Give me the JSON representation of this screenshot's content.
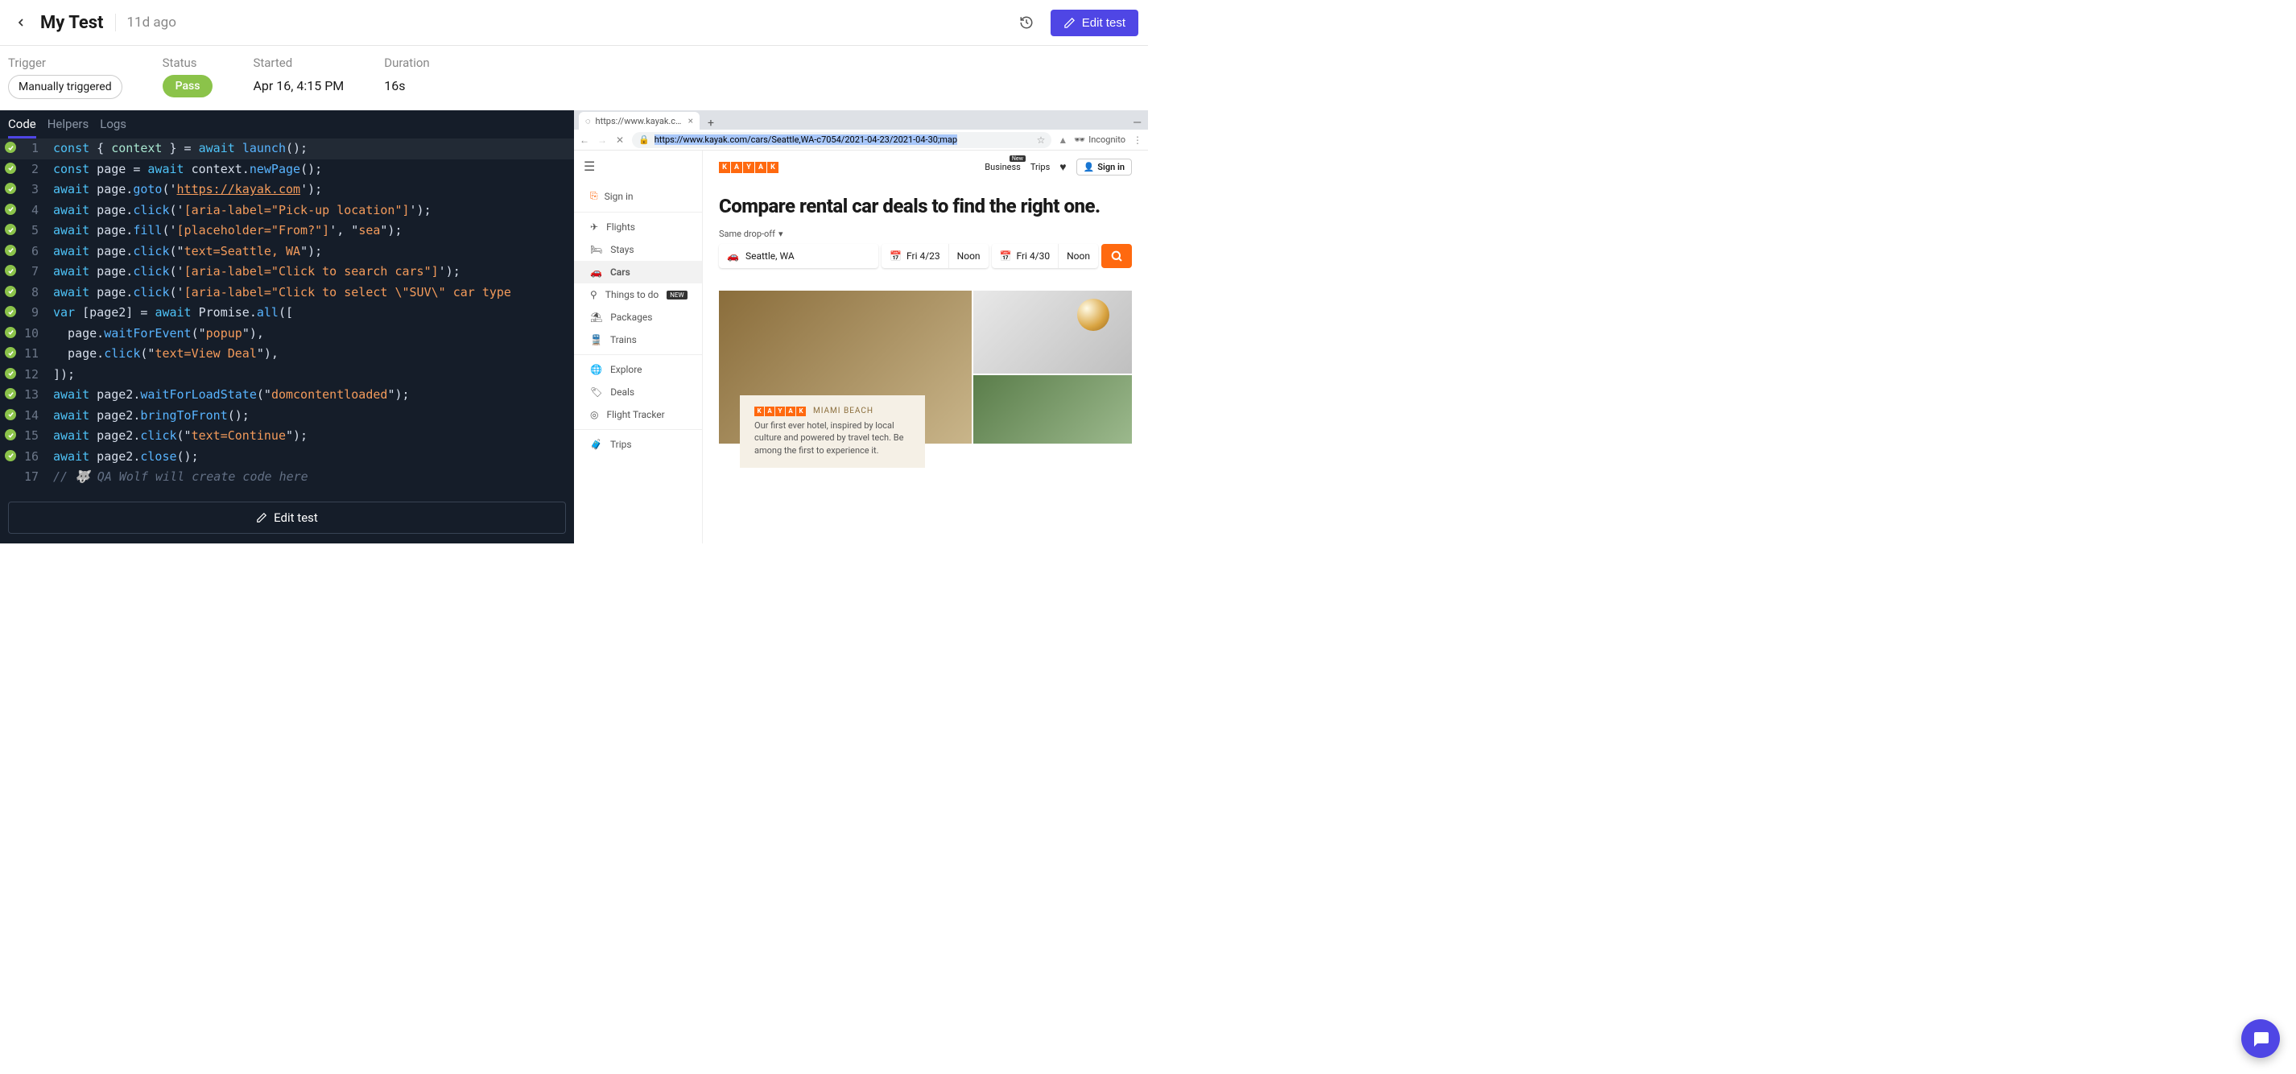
{
  "header": {
    "title": "My Test",
    "age": "11d ago",
    "edit_label": "Edit test"
  },
  "meta": {
    "trigger_label": "Trigger",
    "trigger_value": "Manually triggered",
    "status_label": "Status",
    "status_value": "Pass",
    "started_label": "Started",
    "started_value": "Apr 16, 4:15 PM",
    "duration_label": "Duration",
    "duration_value": "16s"
  },
  "tabs": {
    "code": "Code",
    "helpers": "Helpers",
    "logs": "Logs"
  },
  "code_url": "https://kayak.com",
  "code": {
    "l1_kw1": "const",
    "l1_br1": " { ",
    "l1_id": "context",
    "l1_br2": " } = ",
    "l1_aw": "await",
    "l1_sp": " ",
    "l1_fn": "launch",
    "l1_end": "();",
    "l2_kw": "const",
    "l2_a": " page = ",
    "l2_aw": "await",
    "l2_b": " context.",
    "l2_fn": "newPage",
    "l2_end": "();",
    "l3_aw": "await",
    "l3_a": " page.",
    "l3_fn": "goto",
    "l3_b": "('",
    "l3_end": "');",
    "l4_aw": "await",
    "l4_a": " page.",
    "l4_fn": "click",
    "l4_b": "('",
    "l4_str": "[aria-label=\"Pick-up location\"]",
    "l4_end": "');",
    "l5_aw": "await",
    "l5_a": " page.",
    "l5_fn": "fill",
    "l5_b": "('",
    "l5_str": "[placeholder=\"From?\"]",
    "l5_c": "', \"",
    "l5_str2": "sea",
    "l5_end": "\");",
    "l6_aw": "await",
    "l6_a": " page.",
    "l6_fn": "click",
    "l6_b": "(\"",
    "l6_str": "text=Seattle, WA",
    "l6_end": "\");",
    "l7_aw": "await",
    "l7_a": " page.",
    "l7_fn": "click",
    "l7_b": "('",
    "l7_str": "[aria-label=\"Click to search cars\"]",
    "l7_end": "');",
    "l8_aw": "await",
    "l8_a": " page.",
    "l8_fn": "click",
    "l8_b": "('",
    "l8_str": "[aria-label=\"Click to select \\\"SUV\\\" car type",
    "l9_kw": "var",
    "l9_a": " [page2] = ",
    "l9_aw": "await",
    "l9_b": " Promise.",
    "l9_fn": "all",
    "l9_end": "([",
    "l10_a": "  page.",
    "l10_fn": "waitForEvent",
    "l10_b": "(\"",
    "l10_str": "popup",
    "l10_end": "\"),",
    "l11_a": "  page.",
    "l11_fn": "click",
    "l11_b": "(\"",
    "l11_str": "text=View Deal",
    "l11_end": "\"),",
    "l12": "]);",
    "l13_aw": "await",
    "l13_a": " page2.",
    "l13_fn": "waitForLoadState",
    "l13_b": "(\"",
    "l13_str": "domcontentloaded",
    "l13_end": "\");",
    "l14_aw": "await",
    "l14_a": " page2.",
    "l14_fn": "bringToFront",
    "l14_end": "();",
    "l15_aw": "await",
    "l15_a": " page2.",
    "l15_fn": "click",
    "l15_b": "(\"",
    "l15_str": "text=Continue",
    "l15_end": "\");",
    "l16_aw": "await",
    "l16_a": " page2.",
    "l16_fn": "close",
    "l16_end": "();",
    "l17": "// 🐺 QA Wolf will create code here"
  },
  "bottom_edit": "Edit test",
  "browser": {
    "tab_title": "https://www.kayak.com/ca",
    "address": "https://www.kayak.com/cars/Seattle,WA-c7054/2021-04-23/2021-04-30;map",
    "incognito": "Incognito"
  },
  "kayak": {
    "signin": "Sign in",
    "nav": {
      "flights": "Flights",
      "stays": "Stays",
      "cars": "Cars",
      "things": "Things to do",
      "new": "NEW",
      "packages": "Packages",
      "trains": "Trains",
      "explore": "Explore",
      "deals": "Deals",
      "tracker": "Flight Tracker",
      "trips": "Trips"
    },
    "top": {
      "business": "Business",
      "business_badge": "New",
      "trips": "Trips",
      "signin": "Sign in"
    },
    "headline": "Compare rental car deals to find the right one.",
    "dropoff": "Same drop-off",
    "location": "Seattle, WA",
    "date1": "Fri 4/23",
    "noon1": "Noon",
    "date2": "Fri 4/30",
    "noon2": "Noon",
    "promo_brand": "MIAMI BEACH",
    "promo_text": "Our first ever hotel, inspired by local culture and powered by travel tech. Be among the first to experience it."
  }
}
